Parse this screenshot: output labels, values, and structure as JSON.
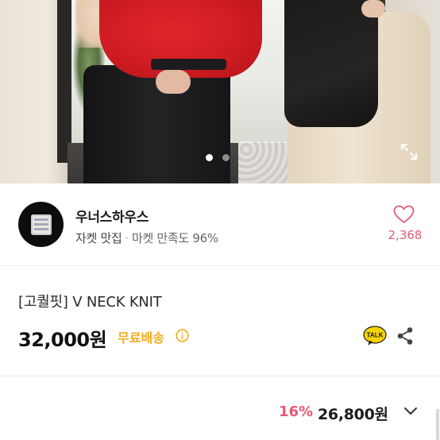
{
  "gallery": {
    "image_label": "product-photo",
    "dot_count": 2,
    "active_index": 0
  },
  "seller": {
    "name": "우너스하우스",
    "tagline": "자켓 맛집",
    "separator": "·",
    "satisfaction": "마켓 만족도 96%",
    "like_count": "2,368"
  },
  "product": {
    "title": "[고퀄핏] V NECK KNIT",
    "price": "32,000원",
    "shipping": "무료배송"
  },
  "bottom_bar": {
    "discount": "16%",
    "sale_price": "26,800원"
  },
  "icons": {
    "expand": "expand-icon",
    "heart": "heart-icon",
    "info": "info-icon",
    "talk": "kakaotalk-icon",
    "share": "share-icon",
    "chevron": "chevron-down-icon",
    "talk_text": "TALK"
  },
  "colors": {
    "accent_pink": "#e25b77",
    "shipping_yellow": "#f2ac1a",
    "talk_yellow": "#f7d400"
  }
}
